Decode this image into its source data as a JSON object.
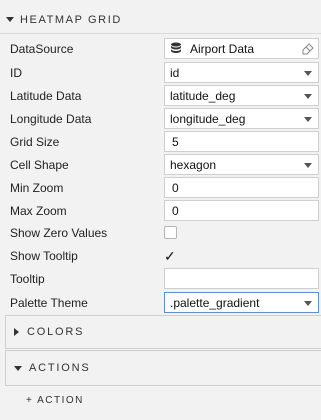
{
  "panel": {
    "title": "HEATMAP GRID"
  },
  "fields": {
    "datasource": {
      "label": "DataSource",
      "value": "Airport Data",
      "icon": "database-icon"
    },
    "id": {
      "label": "ID",
      "value": "id"
    },
    "latitude": {
      "label": "Latitude Data",
      "value": "latitude_deg"
    },
    "longitude": {
      "label": "Longitude Data",
      "value": "longitude_deg"
    },
    "grid_size": {
      "label": "Grid Size",
      "value": "5"
    },
    "cell_shape": {
      "label": "Cell Shape",
      "value": "hexagon"
    },
    "min_zoom": {
      "label": "Min Zoom",
      "value": "0"
    },
    "max_zoom": {
      "label": "Max Zoom",
      "value": "0"
    },
    "show_zero": {
      "label": "Show Zero Values",
      "checked": false
    },
    "show_tooltip": {
      "label": "Show Tooltip",
      "checked": true,
      "mark": "✓"
    },
    "tooltip": {
      "label": "Tooltip",
      "value": ""
    },
    "palette": {
      "label": "Palette Theme",
      "value": ".palette_gradient"
    }
  },
  "sections": {
    "colors": {
      "title": "COLORS",
      "expanded": false
    },
    "actions": {
      "title": "ACTIONS",
      "expanded": true,
      "add_label": "+ ACTION"
    }
  }
}
